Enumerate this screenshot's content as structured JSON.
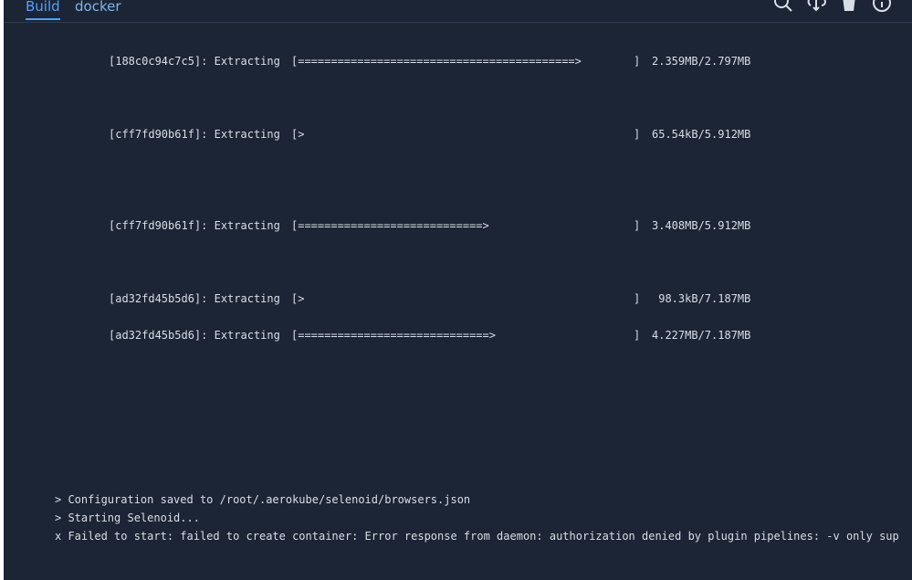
{
  "tabs": [
    {
      "label": "Build"
    },
    {
      "label": "docker"
    }
  ],
  "toolbar": {
    "icons": [
      "search-icon",
      "download-icon",
      "delete-icon",
      "info-icon"
    ]
  },
  "progress_lines": [
    {
      "prefix": "[188c0c94c7c5]: Extracting",
      "bar": "[==========================================>",
      "close": "]",
      "size": "2.359MB/2.797MB"
    },
    {
      "prefix": "[cff7fd90b61f]: Extracting",
      "bar": "[>",
      "close": "]",
      "size": "65.54kB/5.912MB"
    },
    {
      "prefix": "[cff7fd90b61f]: Extracting",
      "bar": "[============================>",
      "close": "]",
      "size": "3.408MB/5.912MB"
    },
    {
      "prefix": "[ad32fd45b5d6]: Extracting",
      "bar": "[>",
      "close": "]",
      "size": " 98.3kB/7.187MB"
    },
    {
      "prefix": "[ad32fd45b5d6]: Extracting",
      "bar": "[=============================>",
      "close": "]",
      "size": "4.227MB/7.187MB"
    }
  ],
  "log_lines": [
    "> Configuration saved to /root/.aerokube/selenoid/browsers.json",
    "> Starting Selenoid...",
    "x Failed to start: failed to create container: Error response from daemon: authorization denied by plugin pipelines: -v only sup"
  ],
  "colors": {
    "background": "#1c2535",
    "accent": "#4ea1ff",
    "text": "#d9dee6"
  }
}
